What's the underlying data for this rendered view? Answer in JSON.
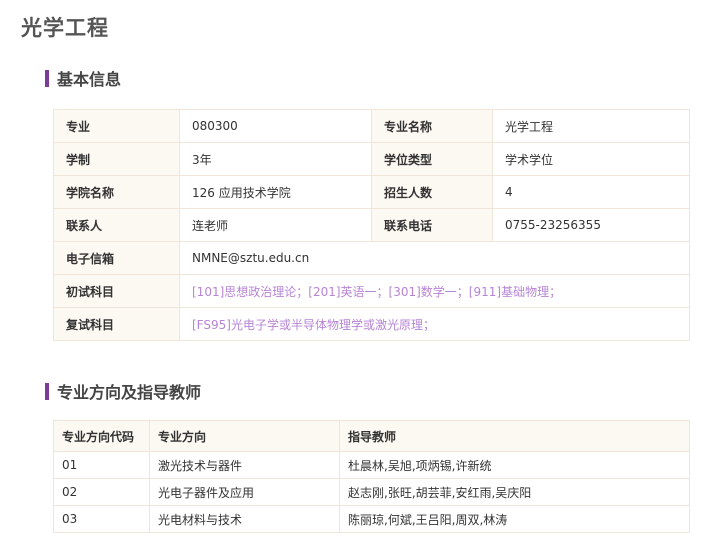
{
  "page": {
    "title": "光学工程"
  },
  "sections": {
    "basic_info": "基本信息",
    "directions": "专业方向及指导教师"
  },
  "basic_info": {
    "major_code_label": "专业",
    "major_code": "080300",
    "major_name_label": "专业名称",
    "major_name": "光学工程",
    "duration_label": "学制",
    "duration": "3年",
    "degree_type_label": "学位类型",
    "degree_type": "学术学位",
    "college_label": "学院名称",
    "college": "126 应用技术学院",
    "enrollment_label": "招生人数",
    "enrollment": "4",
    "contact_label": "联系人",
    "contact": "连老师",
    "phone_label": "联系电话",
    "phone": "0755-23256355",
    "email_label": "电子信箱",
    "email": "NMNE@sztu.edu.cn",
    "prelim_label": "初试科目",
    "prelim": "[101]思想政治理论；[201]英语一；[301]数学一；[911]基础物理；",
    "retest_label": "复试科目",
    "retest": "[FS95]光电子学或半导体物理学或激光原理；"
  },
  "directions_table": {
    "headers": [
      "专业方向代码",
      "专业方向",
      "指导教师"
    ],
    "rows": [
      [
        "01",
        "激光技术与器件",
        "杜晨林,吴旭,项炳锡,许新统"
      ],
      [
        "02",
        "光电子器件及应用",
        "赵志刚,张旺,胡芸菲,安红雨,吴庆阳"
      ],
      [
        "03",
        "光电材料与技术",
        "陈丽琼,何斌,王吕阳,周双,林涛"
      ]
    ]
  },
  "colors": {
    "accent": "#7d3c98",
    "label_bg": "#fcf8f2",
    "border": "#efe6d9",
    "link_purple": "#b784d6"
  }
}
